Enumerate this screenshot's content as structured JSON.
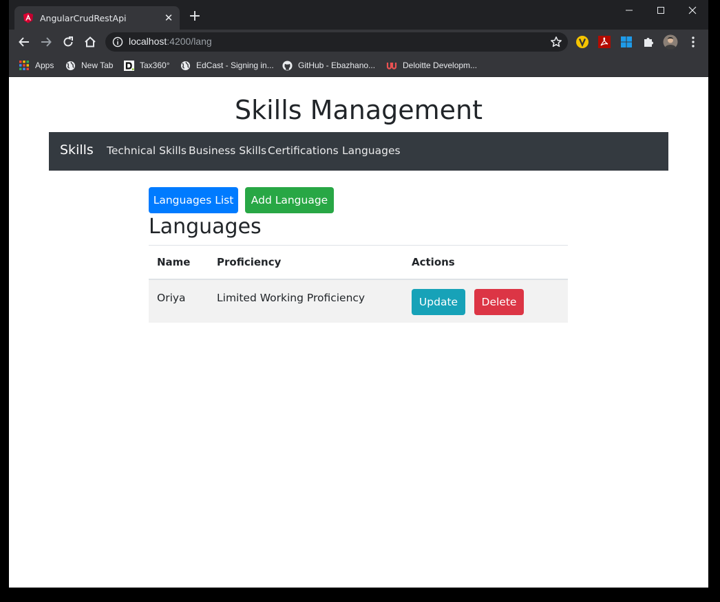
{
  "browser": {
    "tab_title": "AngularCrudRestApi",
    "tab_close": "✕",
    "new_tab": "+",
    "url_host": "localhost",
    "url_path": ":4200/lang"
  },
  "bookmarks": [
    {
      "label": "Apps",
      "icon": "apps-grid-icon"
    },
    {
      "label": "New Tab",
      "icon": "globe-icon"
    },
    {
      "label": "Tax360°",
      "icon": "deloitte-d-icon"
    },
    {
      "label": "EdCast - Signing in...",
      "icon": "globe-icon"
    },
    {
      "label": "GitHub - Ebazhano...",
      "icon": "github-icon"
    },
    {
      "label": "Deloitte Developm...",
      "icon": "udemy-icon"
    }
  ],
  "page": {
    "title": "Skills Management",
    "navbar": {
      "brand": "Skills",
      "links": [
        "Technical Skills",
        "Business Skills",
        "Certifications",
        "Languages"
      ]
    },
    "buttons": {
      "list": "Languages List",
      "add": "Add Language"
    },
    "section_title": "Languages",
    "table": {
      "headers": [
        "Name",
        "Proficiency",
        "Actions"
      ],
      "rows": [
        {
          "name": "Oriya",
          "proficiency": "Limited Working Proficiency",
          "update": "Update",
          "delete": "Delete"
        }
      ]
    }
  },
  "colors": {
    "navbar": "#343a40",
    "primary": "#007bff",
    "success": "#28a745",
    "info": "#17a2b8",
    "danger": "#dc3545"
  }
}
